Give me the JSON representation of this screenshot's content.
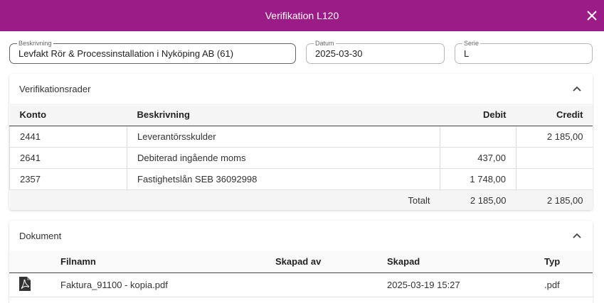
{
  "dialog": {
    "title": "Verifikation L120"
  },
  "fields": {
    "beskrivning": {
      "label": "Beskrivning",
      "value": "Levfakt Rör & Processinstallation i Nyköping AB (61)"
    },
    "datum": {
      "label": "Datum",
      "value": "2025-03-30"
    },
    "serie": {
      "label": "Serie",
      "value": "L"
    }
  },
  "verifikationsrader": {
    "title": "Verifikationsrader",
    "columns": {
      "konto": "Konto",
      "beskrivning": "Beskrivning",
      "debit": "Debit",
      "credit": "Credit"
    },
    "rows": [
      {
        "konto": "2441",
        "beskrivning": "Leverantörsskulder",
        "debit": "",
        "credit": "2 185,00"
      },
      {
        "konto": "2641",
        "beskrivning": "Debiterad ingående moms",
        "debit": "437,00",
        "credit": ""
      },
      {
        "konto": "2357",
        "beskrivning": "Fastighetslån SEB 36092998",
        "debit": "1 748,00",
        "credit": ""
      }
    ],
    "total": {
      "label": "Totalt",
      "debit": "2 185,00",
      "credit": "2 185,00"
    }
  },
  "dokument": {
    "title": "Dokument",
    "columns": {
      "filnamn": "Filnamn",
      "skapad_av": "Skapad av",
      "skapad": "Skapad",
      "typ": "Typ"
    },
    "rows": [
      {
        "icon": "pdf-file-icon",
        "filnamn": "Faktura_91100 - kopia.pdf",
        "skapad_av": "",
        "skapad": "2025-03-19 15:27",
        "typ": ".pdf"
      }
    ]
  },
  "colors": {
    "header": "#9b1b87"
  }
}
